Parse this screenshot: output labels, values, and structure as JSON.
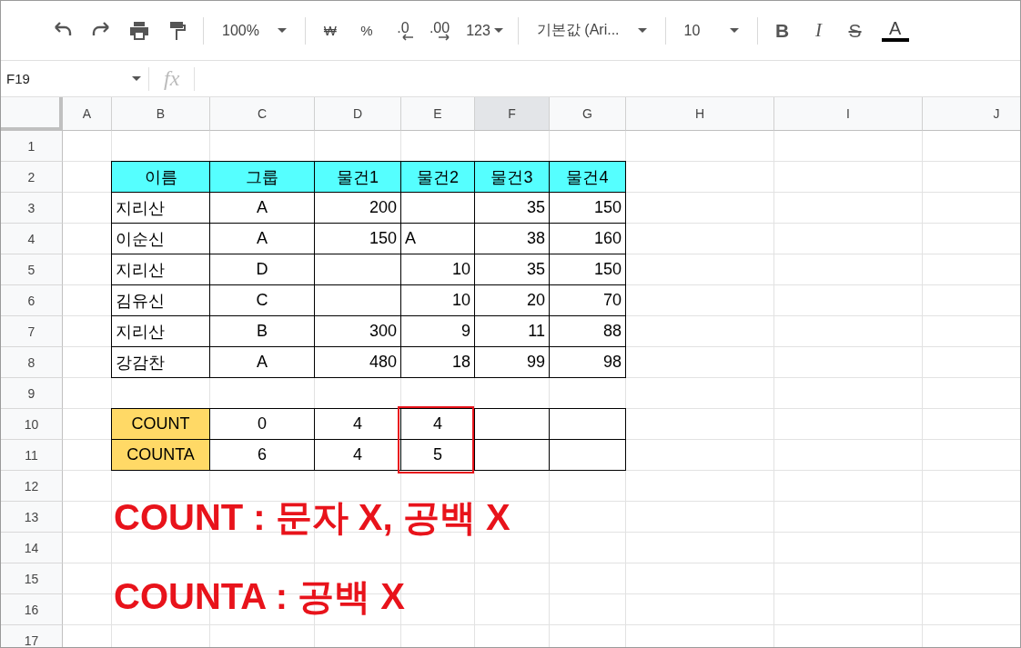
{
  "toolbar": {
    "items": [
      {
        "kind": "undo"
      },
      {
        "kind": "redo"
      },
      {
        "kind": "print"
      },
      {
        "kind": "paint-format"
      },
      {
        "kind": "separator"
      },
      {
        "kind": "dropdown",
        "label": "100%"
      },
      {
        "kind": "separator"
      },
      {
        "kind": "text",
        "label": "₩"
      },
      {
        "kind": "text",
        "label": "%"
      },
      {
        "kind": "decrease-decimal",
        "label": ".0"
      },
      {
        "kind": "increase-decimal",
        "label": ".00"
      },
      {
        "kind": "menu",
        "label": "123"
      },
      {
        "kind": "separator"
      },
      {
        "kind": "dropdown",
        "label": "기본값 (Ari..."
      },
      {
        "kind": "separator"
      },
      {
        "kind": "dropdown",
        "label": "10"
      },
      {
        "kind": "separator"
      },
      {
        "kind": "bold",
        "label": "B"
      },
      {
        "kind": "italic",
        "label": "I"
      },
      {
        "kind": "strike",
        "label": "S"
      },
      {
        "kind": "text-color",
        "label": "A",
        "color": "#000000"
      }
    ]
  },
  "formula_bar": {
    "name_box": "F19",
    "fx": "fx"
  },
  "sheet": {
    "columns": [
      {
        "label": "A",
        "selected": false
      },
      {
        "label": "B",
        "selected": false
      },
      {
        "label": "C",
        "selected": false
      },
      {
        "label": "D",
        "selected": false
      },
      {
        "label": "E",
        "selected": false
      },
      {
        "label": "F",
        "selected": true
      },
      {
        "label": "G",
        "selected": false
      },
      {
        "label": "H",
        "selected": false
      },
      {
        "label": "I",
        "selected": false
      },
      {
        "label": "J",
        "selected": false
      }
    ],
    "row_numbers": [
      "1",
      "2",
      "3",
      "4",
      "5",
      "6",
      "7",
      "8",
      "9",
      "10",
      "11",
      "12",
      "13",
      "14",
      "15",
      "16",
      "17"
    ],
    "data_table": {
      "header": [
        "이름",
        "그룹",
        "물건1",
        "물건2",
        "물건3",
        "물건4"
      ],
      "rows": [
        [
          "지리산",
          "A",
          "200",
          null,
          "35",
          "150"
        ],
        [
          "이순신",
          "A",
          "150",
          "A",
          "38",
          "160"
        ],
        [
          "지리산",
          "D",
          null,
          "10",
          "35",
          "150"
        ],
        [
          "김유신",
          "C",
          null,
          "10",
          "20",
          "70"
        ],
        [
          "지리산",
          "B",
          "300",
          "9",
          "11",
          "88"
        ],
        [
          "강감찬",
          "A",
          "480",
          "18",
          "99",
          "98"
        ]
      ]
    },
    "count_table": {
      "rows": [
        {
          "label": "COUNT",
          "values": [
            "0",
            "4",
            "4"
          ]
        },
        {
          "label": "COUNTA",
          "values": [
            "6",
            "4",
            "5"
          ]
        }
      ]
    },
    "highlight": {
      "color": "#e8131b"
    },
    "annotations": [
      {
        "text": "COUNT : 문자 X, 공백 X",
        "color": "#e8131b"
      },
      {
        "text": "COUNTA : 공백 X",
        "color": "#e8131b"
      }
    ]
  }
}
